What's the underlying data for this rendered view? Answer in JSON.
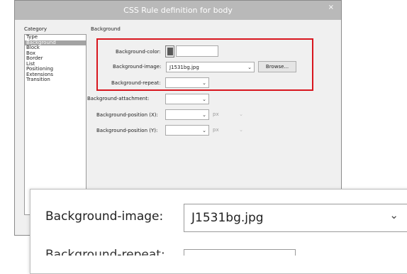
{
  "window": {
    "title": "CSS Rule definition for body",
    "close_glyph": "×"
  },
  "category": {
    "label": "Category",
    "items": [
      "Type",
      "Background",
      "Block",
      "Box",
      "Border",
      "List",
      "Positioning",
      "Extensions",
      "Transition"
    ],
    "selected": "Background"
  },
  "section": {
    "title": "Background"
  },
  "fields": {
    "bg_color_label": "Background-color:",
    "bg_color_value": "",
    "bg_image_label": "Background-image:",
    "bg_image_value": "J1531bg.jpg",
    "browse_label": "Browse...",
    "bg_repeat_label": "Background-repeat:",
    "bg_repeat_value": "",
    "bg_attach_label": "Background-attachment:",
    "bg_attach_value": "",
    "bg_pos_x_label": "Background-position (X):",
    "bg_pos_y_label": "Background-position (Y):",
    "unit_px": "px"
  },
  "zoom": {
    "label": "Background-image:",
    "value": "J1531bg.jpg",
    "next_label_partial": "Background-repeat:"
  },
  "icons": {
    "dropdown": "chevron-down-icon",
    "swatch": "color-swatch-icon"
  },
  "colors": {
    "highlight": "#d8161e",
    "titlebar": "#b9b9b9",
    "selected_item": "#a3a3a3"
  }
}
